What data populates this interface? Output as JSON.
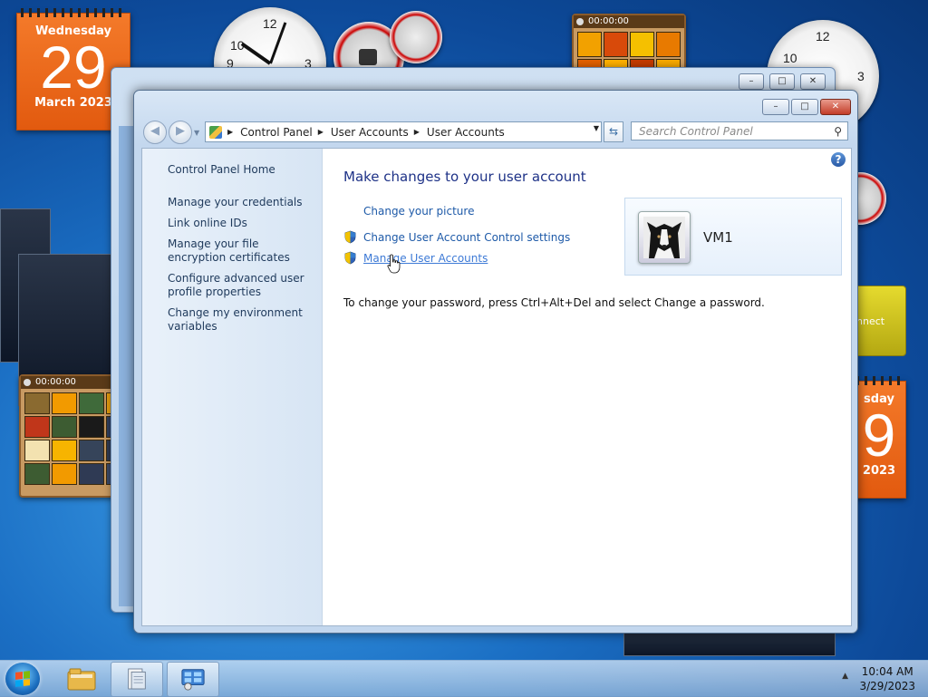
{
  "desktop": {
    "calendar_left": {
      "weekday": "Wednesday",
      "day": "29",
      "month_year": "March 2023"
    },
    "calendar_right": {
      "weekday": "sday",
      "day": "9",
      "month_year": "2023"
    },
    "puzzle_timer_top": "00:00:00",
    "puzzle_timer_left": "00:00:00",
    "gadget_partial_label": "nnect"
  },
  "window": {
    "breadcrumb": [
      "Control Panel",
      "User Accounts",
      "User Accounts"
    ],
    "search_placeholder": "Search Control Panel",
    "left_nav": {
      "home": "Control Panel Home",
      "items": [
        "Manage your credentials",
        "Link online IDs",
        "Manage your file encryption certificates",
        "Configure advanced user profile properties",
        "Change my environment variables"
      ]
    },
    "heading": "Make changes to your user account",
    "tasks": {
      "change_picture": "Change your picture",
      "uac_settings": "Change User Account Control settings",
      "manage_accounts": "Manage User Accounts"
    },
    "password_note": "To change your password, press Ctrl+Alt+Del and select Change a password.",
    "user": {
      "name": "VM1"
    },
    "help_glyph": "?"
  },
  "taskbar": {
    "time": "10:04 AM",
    "date": "3/29/2023"
  },
  "colors": {
    "link": "#1e5aa8",
    "heading": "#1e3287",
    "calendar": "#e25a0f",
    "desktop": "#1b6fc4"
  }
}
